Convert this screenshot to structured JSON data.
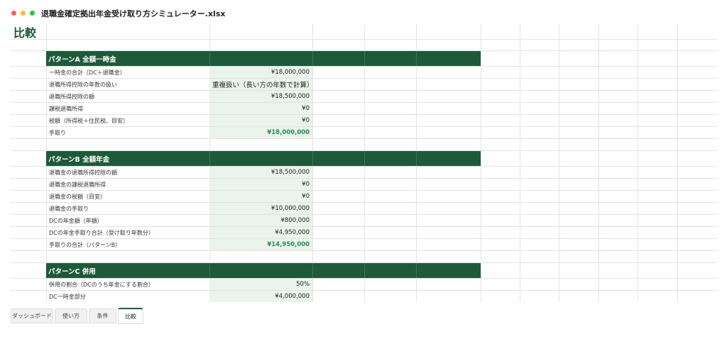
{
  "window": {
    "title": "退職金確定拠出年金受け取り方シミュレーター.xlsx"
  },
  "sheet": {
    "title": "比較",
    "sections": [
      {
        "title": "パターンA 全額一時金",
        "rows": [
          {
            "label": "一時金の合計（DC＋退職金）",
            "value": "¥18,000,000"
          },
          {
            "label": "退職所得控除の年数の扱い",
            "value": "重複扱い（長い方の年数で計算）"
          },
          {
            "label": "退職所得控除の額",
            "value": "¥18,500,000"
          },
          {
            "label": "課税退職所得",
            "value": "¥0"
          },
          {
            "label": "税額（所得税＋住民税、目安）",
            "value": "¥0"
          },
          {
            "label": "手取り",
            "value": "¥18,000,000"
          }
        ]
      },
      {
        "title": "パターンB 全額年金",
        "rows": [
          {
            "label": "退職金の退職所得控除の額",
            "value": "¥18,500,000"
          },
          {
            "label": "退職金の課税退職所得",
            "value": "¥0"
          },
          {
            "label": "退職金の税額（目安）",
            "value": "¥0"
          },
          {
            "label": "退職金の手取り",
            "value": "¥10,000,000"
          },
          {
            "label": "DCの年金額（年額）",
            "value": "¥800,000"
          },
          {
            "label": "DCの年金手取り合計（受け取り年数分）",
            "value": "¥4,950,000"
          },
          {
            "label": "手取りの合計（パターンB）",
            "value": "¥14,950,000"
          }
        ]
      },
      {
        "title": "パターンC 併用",
        "rows": [
          {
            "label": "併用の割合（DCのうち年金にする割合）",
            "value": "50%"
          },
          {
            "label": "DC一時金部分",
            "value": "¥4,000,000"
          }
        ]
      }
    ]
  },
  "tabs": [
    "ダッシュボード",
    "使い方",
    "条件",
    "比較"
  ],
  "active_tab": "比較",
  "colors": {
    "header_band": "#1e5a3a",
    "value_fill": "#eaf3ec",
    "total_text": "#2e8b4f"
  }
}
